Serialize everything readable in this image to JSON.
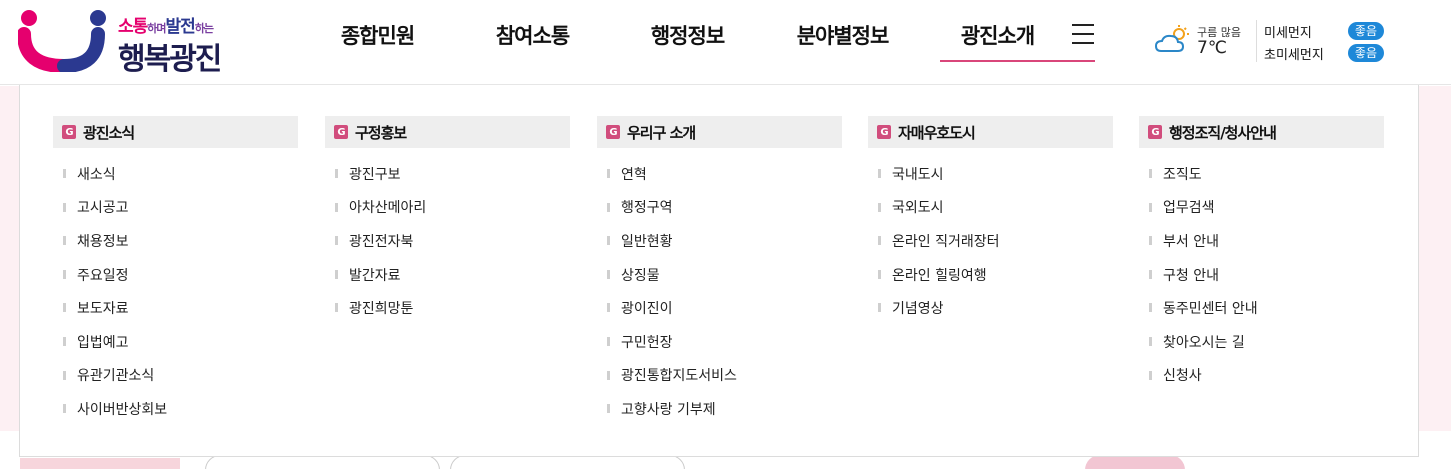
{
  "logo": {
    "top_text": [
      "소통",
      "하며",
      "발전",
      "하는"
    ],
    "bottom_text": "행복광진"
  },
  "gnb": {
    "items": [
      {
        "label": "종합민원"
      },
      {
        "label": "참여소통"
      },
      {
        "label": "행정정보"
      },
      {
        "label": "분야별정보"
      },
      {
        "label": "광진소개",
        "active": true
      }
    ]
  },
  "weather": {
    "icon": "cloud-sun-icon",
    "description": "구름 많음",
    "temperature": "7℃"
  },
  "air": {
    "fine_dust_label": "미세먼지",
    "fine_dust_status": "좋음",
    "ultrafine_dust_label": "초미세먼지",
    "ultrafine_dust_status": "좋음"
  },
  "mega_menu": {
    "columns": [
      {
        "title": "광진소식",
        "items": [
          "새소식",
          "고시공고",
          "채용정보",
          "주요일정",
          "보도자료",
          "입법예고",
          "유관기관소식",
          "사이버반상회보"
        ]
      },
      {
        "title": "구정홍보",
        "items": [
          "광진구보",
          "아차산메아리",
          "광진전자북",
          "발간자료",
          "광진희망툰"
        ]
      },
      {
        "title": "우리구 소개",
        "items": [
          "연혁",
          "행정구역",
          "일반현황",
          "상징물",
          "광이진이",
          "구민헌장",
          "광진통합지도서비스",
          "고향사랑 기부제"
        ]
      },
      {
        "title": "자매우호도시",
        "items": [
          "국내도시",
          "국외도시",
          "온라인 직거래장터",
          "온라인 힐링여행",
          "기념영상"
        ]
      },
      {
        "title": "행정조직/청사안내",
        "items": [
          "조직도",
          "업무검색",
          "부서 안내",
          "구청 안내",
          "동주민센터 안내",
          "찾아오시는 길",
          "신청사"
        ]
      }
    ]
  },
  "colors": {
    "accent": "#d14d7d",
    "badge": "#1e88d8"
  }
}
